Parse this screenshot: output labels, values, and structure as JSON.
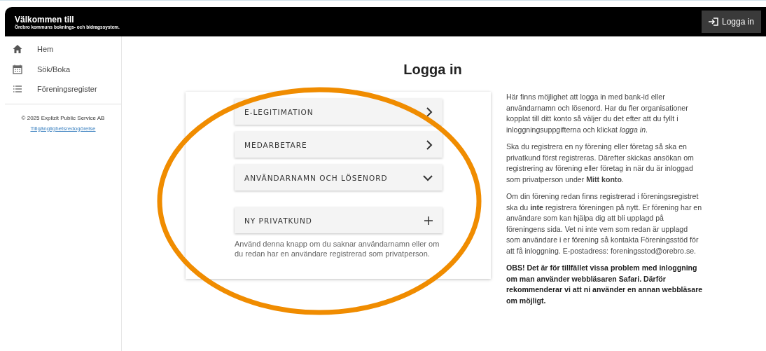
{
  "header": {
    "title": "Välkommen till",
    "subtitle": "Örebro kommuns boknings- och bidragssystem.",
    "login_button": "Logga in"
  },
  "sidebar": {
    "items": [
      {
        "label": "Hem",
        "kind": "home"
      },
      {
        "label": "Sök/Boka",
        "kind": "calendar"
      },
      {
        "label": "Föreningsregister",
        "kind": "list"
      }
    ],
    "copyright": "© 2025 Explizit Public Service AB",
    "accessibility_link": "Tillgänglighetsredogörelse"
  },
  "main": {
    "title": "Logga in",
    "options": [
      {
        "label": "E-LEGITIMATION",
        "kind": "chevron-right"
      },
      {
        "label": "MEDARBETARE",
        "kind": "chevron-right"
      },
      {
        "label": "ANVÄNDARNAMN OCH LÖSENORD",
        "kind": "chevron-down"
      }
    ],
    "new_customer": {
      "label": "NY PRIVATKUND",
      "hint": "Använd denna knapp om du saknar användarnamn eller om du redan har en användare registrerad som privatperson."
    },
    "info": [
      "Här finns möjlighet att logga in med bank-id eller användarnamn och lösenord. Har du fler organisationer kopplat till ditt konto så väljer du det efter att du fyllt i inloggningsuppgifterna och klickat *logga in*.",
      "Ska du registrera en ny förening eller företag så ska en privatkund först registreras. Därefter skickas ansökan om registrering av förening eller företag in när du är inloggad som privatperson under **Mitt konto**.",
      "Om din förening redan finns registrerad i föreningsregistret ska du **inte** registrera föreningen på nytt. Er förening har en användare som kan hjälpa dig att bli upplagd på föreningens sida. Vet ni inte vem som redan är upplagd som användare i er förening så kontakta Föreningsstöd för att få inloggning. E-postadress: foreningsstod@orebro.se."
    ],
    "warning": "OBS! Det är för tillfället vissa problem med inloggning om man använder webbläsaren Safari. Därför rekommenderar vi att ni använder en annan webbläsare om möjligt."
  },
  "annotation": {
    "kind": "ellipse",
    "color": "#f08c00"
  }
}
